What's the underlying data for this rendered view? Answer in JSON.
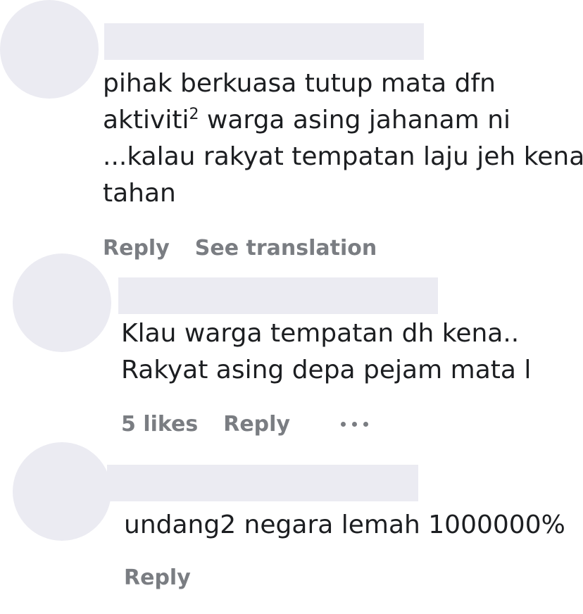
{
  "comments": [
    {
      "lines": [
        "pihak berkuasa tutup mata dfn",
        "warga asing jahanam ni",
        "...kalau rakyat tempatan laju jeh kena",
        "tahan"
      ],
      "line2_word": "aktiviti",
      "line2_sup": "2",
      "actions": {
        "reply": "Reply",
        "see_translation": "See translation"
      }
    },
    {
      "lines": [
        "Klau warga tempatan dh kena..",
        "Rakyat asing depa pejam mata l"
      ],
      "actions": {
        "likes": "5 likes",
        "reply": "Reply"
      }
    },
    {
      "lines": [
        "undang2 negara lemah 1000000%"
      ],
      "actions": {
        "reply": "Reply"
      }
    }
  ],
  "icons": {
    "more": "more-options-icon"
  },
  "colors": {
    "placeholder": "#ebebf2",
    "text": "#1c1e21",
    "secondary": "#7a7d82"
  }
}
